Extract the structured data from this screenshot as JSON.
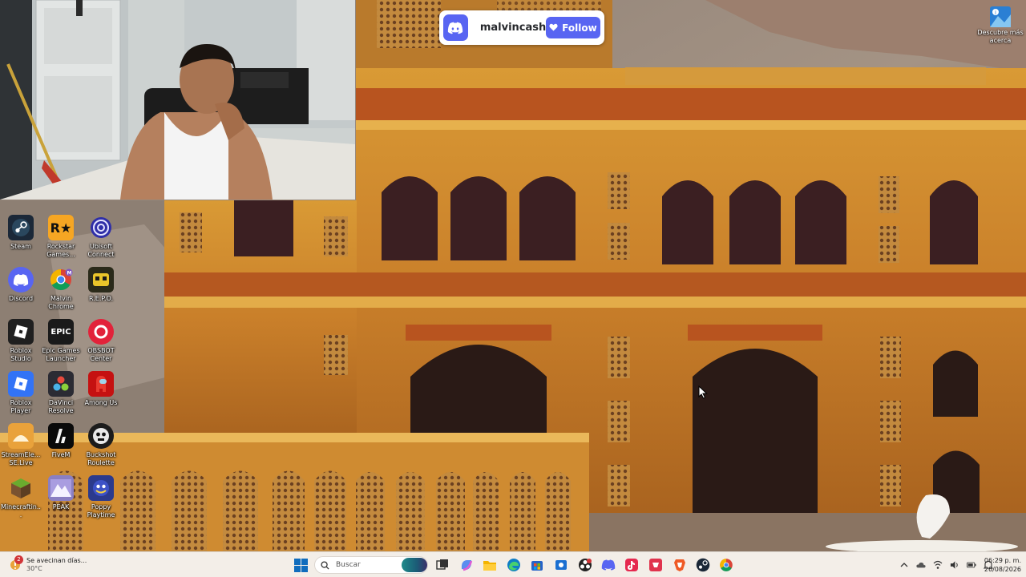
{
  "stream_alert": {
    "platform_icon": "discord-icon",
    "username": "malvincash",
    "follow_label": "Follow",
    "accent": "#5865f2"
  },
  "discover_widget": {
    "label": "Descubre más acerca",
    "icon": "spotlight-icon"
  },
  "desktop_icons": [
    {
      "label": "Steam",
      "icon": "steam-icon",
      "color": "#1b2838"
    },
    {
      "label": "Rockstar Games...",
      "icon": "rockstar-icon",
      "color": "#f6a623"
    },
    {
      "label": "Ubisoft Connect",
      "icon": "ubisoft-icon",
      "color": "#1d1d6b"
    },
    {
      "label": "Discord",
      "icon": "discord-icon",
      "color": "#5865f2"
    },
    {
      "label": "Malvin Chrome",
      "icon": "chrome-icon",
      "color": "#4285f4"
    },
    {
      "label": "R.E.P.O.",
      "icon": "repo-icon",
      "color": "#2a2a1a"
    },
    {
      "label": "Roblox Studio",
      "icon": "roblox-studio-icon",
      "color": "#222222"
    },
    {
      "label": "Epic Games Launcher",
      "icon": "epic-games-icon",
      "color": "#1a1a1a"
    },
    {
      "label": "OBSBOT Center",
      "icon": "obsbot-icon",
      "color": "#e2223a"
    },
    {
      "label": "Roblox Player",
      "icon": "roblox-player-icon",
      "color": "#3273f6"
    },
    {
      "label": "DaVinci Resolve",
      "icon": "davinci-icon",
      "color": "#2b2b33"
    },
    {
      "label": "Among Us",
      "icon": "among-us-icon",
      "color": "#c51111"
    },
    {
      "label": "StreamEle... SE.Live",
      "icon": "streamelements-icon",
      "color": "#e9a23b"
    },
    {
      "label": "FiveM",
      "icon": "fivem-icon",
      "color": "#0a0a0a"
    },
    {
      "label": "Buckshot Roulette",
      "icon": "buckshot-icon",
      "color": "#1c1c1c"
    },
    {
      "label": "Minecraftin...",
      "icon": "minecraft-icon",
      "color": "#5a8f2c"
    },
    {
      "label": "PEAK",
      "icon": "peak-icon",
      "color": "#8a7fc2"
    },
    {
      "label": "Poppy Playtime",
      "icon": "poppy-icon",
      "color": "#2b3a8c"
    }
  ],
  "taskbar": {
    "weather": {
      "title": "Se avecinan días...",
      "temp": "30°C",
      "badge": "2",
      "icon": "weather-alert-icon"
    },
    "search_placeholder": "Buscar",
    "apps": [
      {
        "icon": "task-view-icon",
        "color": "#3a3a3a"
      },
      {
        "icon": "copilot-icon",
        "color": "#5b8def"
      },
      {
        "icon": "file-explorer-icon",
        "color": "#f4b400"
      },
      {
        "icon": "edge-icon",
        "color": "#0f7dc5"
      },
      {
        "icon": "store-icon",
        "color": "#2563c9"
      },
      {
        "icon": "obsbot-taskbar-icon",
        "color": "#1b6fd1"
      },
      {
        "icon": "obs-icon",
        "color": "#222222"
      },
      {
        "icon": "discord-taskbar-icon",
        "color": "#5865f2"
      },
      {
        "icon": "tiktok-live-icon",
        "color": "#e5284f"
      },
      {
        "icon": "streamlabs-icon",
        "color": "#e0334d"
      },
      {
        "icon": "brave-icon",
        "color": "#ef5a25"
      },
      {
        "icon": "steam-taskbar-icon",
        "color": "#1b2838"
      },
      {
        "icon": "chrome-taskbar-icon",
        "color": "#4285f4"
      }
    ],
    "tray": [
      "chevron-up-icon",
      "network-icon",
      "volume-icon",
      "battery-icon",
      "notification-icon"
    ],
    "time": "06:29 p. m.",
    "date": "26/08/2026"
  }
}
